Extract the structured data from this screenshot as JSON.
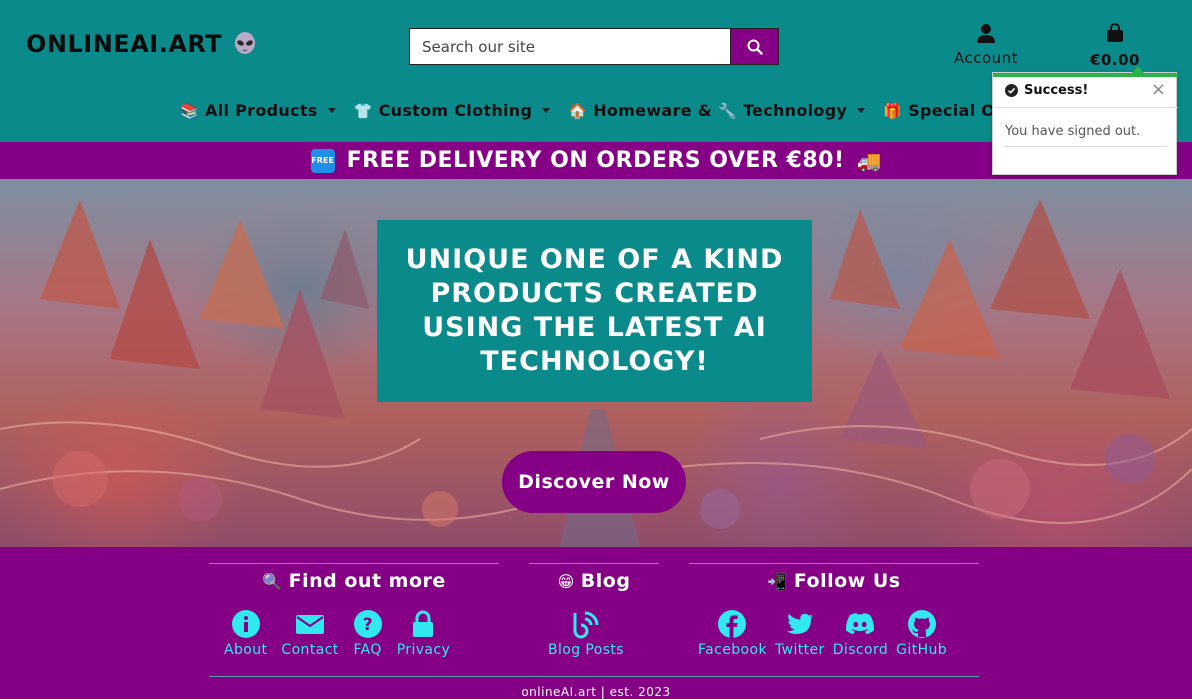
{
  "brand": {
    "logo_text": "ONLINEAI.ART",
    "logo_icon": "alien-icon"
  },
  "search": {
    "placeholder": "Search our site",
    "button_icon": "search-icon"
  },
  "account": {
    "label": "Account",
    "icon": "user-icon"
  },
  "bag": {
    "label": "€0.00",
    "icon": "shopping-bag-icon"
  },
  "nav": {
    "items": [
      {
        "emoji": "📚",
        "label": "All Products"
      },
      {
        "emoji": "👕",
        "label": "Custom Clothing"
      },
      {
        "emoji": "🏠",
        "label": "Homeware & "
      },
      {
        "emoji": "🔧",
        "label": "Technology"
      },
      {
        "emoji": "🎁",
        "label": "Special Offers"
      }
    ]
  },
  "banner": {
    "text": "FREE DELIVERY ON ORDERS OVER €80!",
    "badge": "FREE",
    "truck_emoji": "🚚"
  },
  "toast": {
    "title": "Success!",
    "message": "You have signed out.",
    "close": "×"
  },
  "hero": {
    "heading": "UNIQUE ONE OF A KIND PRODUCTS CREATED USING THE LATEST AI TECHNOLOGY!",
    "cta": "Discover Now"
  },
  "footer": {
    "find_out_more": {
      "emoji": "🔍",
      "title": "Find out more",
      "links": [
        "About",
        "Contact",
        "FAQ",
        "Privacy"
      ]
    },
    "blog": {
      "emoji": "😁",
      "title": "Blog",
      "links": [
        "Blog Posts"
      ]
    },
    "follow": {
      "emoji": "📲",
      "title": "Follow Us",
      "links": [
        "Facebook",
        "Twitter",
        "Discord",
        "GitHub"
      ]
    },
    "copyright": "onlineAI.art | est. 2023"
  },
  "colors": {
    "teal": "#0a8a8a",
    "purple": "#850085",
    "cyan_link": "#30e8ee",
    "success_green": "#2bb34a"
  }
}
